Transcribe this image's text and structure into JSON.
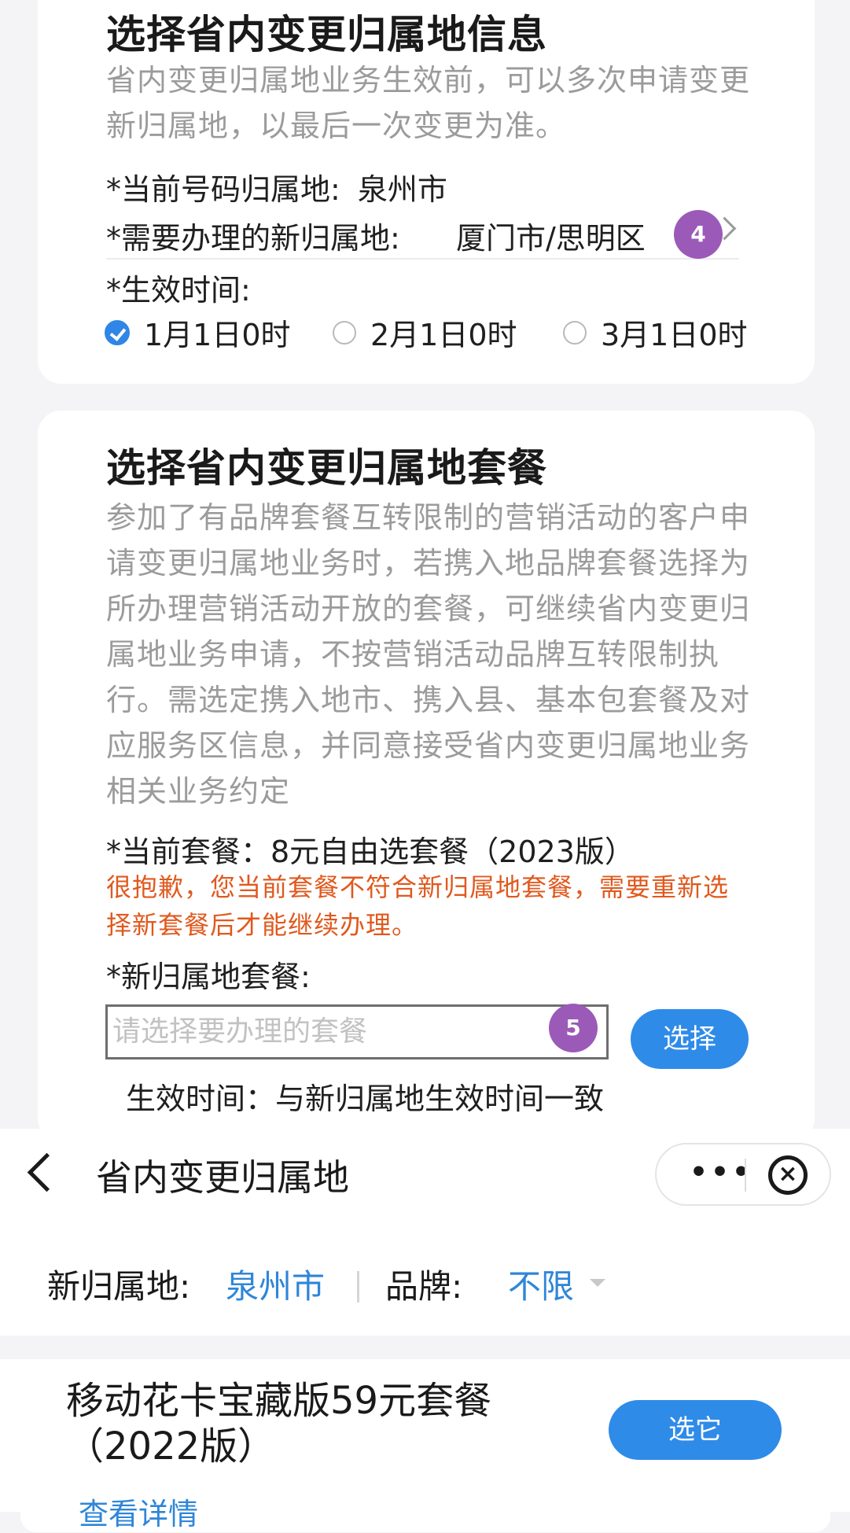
{
  "location_section": {
    "title": "选择省内变更归属地信息",
    "desc": "省内变更归属地业务生效前，可以多次申请变更新归属地，以最后一次变更为准。",
    "current_label": "*当前号码归属地:",
    "current_value": "泉州市",
    "new_label": "*需要办理的新归属地:",
    "new_value": "厦门市/思明区",
    "badge": "4",
    "effective_label": "*生效时间:",
    "options": [
      {
        "label": "1月1日0时",
        "checked": true
      },
      {
        "label": "2月1日0时",
        "checked": false
      },
      {
        "label": "3月1日0时",
        "checked": false
      }
    ]
  },
  "package_section": {
    "title": "选择省内变更归属地套餐",
    "desc": "参加了有品牌套餐互转限制的营销活动的客户申请变更归属地业务时，若携入地品牌套餐选择为所办理营销活动开放的套餐，可继续省内变更归属地业务申请，不按营销活动品牌互转限制执行。需选定携入地市、携入县、基本包套餐及对应服务区信息，并同意接受省内变更归属地业务相关业务约定",
    "current_pkg": "*当前套餐：8元自由选套餐（2023版）",
    "warning": "很抱歉，您当前套餐不符合新归属地套餐，需要重新选择新套餐后才能继续办理。",
    "new_pkg_label": "*新归属地套餐:",
    "input_placeholder": "请选择要办理的套餐",
    "badge": "5",
    "select_button": "选择",
    "effective_note": "生效时间：与新归属地生效时间一致"
  },
  "miniapp": {
    "nav_title": "省内变更归属地",
    "more_icon": "•••",
    "close_icon": "×",
    "filter_location_label": "新归属地:",
    "filter_location_value": "泉州市",
    "filter_brand_label": "品牌:",
    "filter_brand_value": "不限",
    "package_name": "移动花卡宝藏版59元套餐（2022版）",
    "choose_button": "选它",
    "detail_link": "查看详情"
  },
  "colors": {
    "accent_blue": "#2f8be8",
    "warning_orange": "#e0591e",
    "badge_purple": "#9b5ab7"
  }
}
